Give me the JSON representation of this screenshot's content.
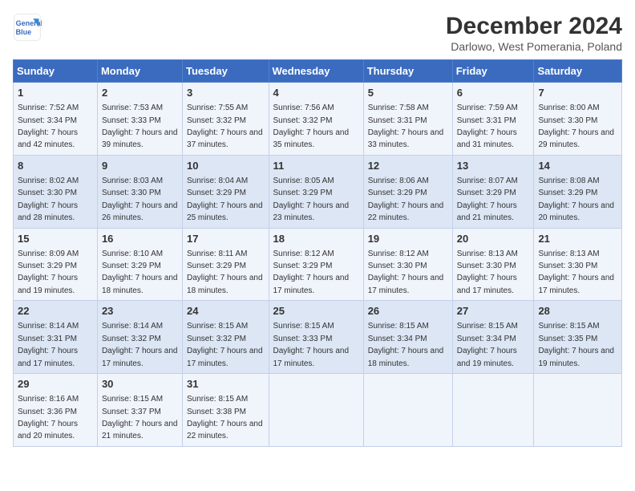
{
  "logo": {
    "line1": "General",
    "line2": "Blue"
  },
  "title": "December 2024",
  "subtitle": "Darlowo, West Pomerania, Poland",
  "weekdays": [
    "Sunday",
    "Monday",
    "Tuesday",
    "Wednesday",
    "Thursday",
    "Friday",
    "Saturday"
  ],
  "weeks": [
    [
      {
        "day": "1",
        "sunrise": "7:52 AM",
        "sunset": "3:34 PM",
        "daylight": "7 hours and 42 minutes."
      },
      {
        "day": "2",
        "sunrise": "7:53 AM",
        "sunset": "3:33 PM",
        "daylight": "7 hours and 39 minutes."
      },
      {
        "day": "3",
        "sunrise": "7:55 AM",
        "sunset": "3:32 PM",
        "daylight": "7 hours and 37 minutes."
      },
      {
        "day": "4",
        "sunrise": "7:56 AM",
        "sunset": "3:32 PM",
        "daylight": "7 hours and 35 minutes."
      },
      {
        "day": "5",
        "sunrise": "7:58 AM",
        "sunset": "3:31 PM",
        "daylight": "7 hours and 33 minutes."
      },
      {
        "day": "6",
        "sunrise": "7:59 AM",
        "sunset": "3:31 PM",
        "daylight": "7 hours and 31 minutes."
      },
      {
        "day": "7",
        "sunrise": "8:00 AM",
        "sunset": "3:30 PM",
        "daylight": "7 hours and 29 minutes."
      }
    ],
    [
      {
        "day": "8",
        "sunrise": "8:02 AM",
        "sunset": "3:30 PM",
        "daylight": "7 hours and 28 minutes."
      },
      {
        "day": "9",
        "sunrise": "8:03 AM",
        "sunset": "3:30 PM",
        "daylight": "7 hours and 26 minutes."
      },
      {
        "day": "10",
        "sunrise": "8:04 AM",
        "sunset": "3:29 PM",
        "daylight": "7 hours and 25 minutes."
      },
      {
        "day": "11",
        "sunrise": "8:05 AM",
        "sunset": "3:29 PM",
        "daylight": "7 hours and 23 minutes."
      },
      {
        "day": "12",
        "sunrise": "8:06 AM",
        "sunset": "3:29 PM",
        "daylight": "7 hours and 22 minutes."
      },
      {
        "day": "13",
        "sunrise": "8:07 AM",
        "sunset": "3:29 PM",
        "daylight": "7 hours and 21 minutes."
      },
      {
        "day": "14",
        "sunrise": "8:08 AM",
        "sunset": "3:29 PM",
        "daylight": "7 hours and 20 minutes."
      }
    ],
    [
      {
        "day": "15",
        "sunrise": "8:09 AM",
        "sunset": "3:29 PM",
        "daylight": "7 hours and 19 minutes."
      },
      {
        "day": "16",
        "sunrise": "8:10 AM",
        "sunset": "3:29 PM",
        "daylight": "7 hours and 18 minutes."
      },
      {
        "day": "17",
        "sunrise": "8:11 AM",
        "sunset": "3:29 PM",
        "daylight": "7 hours and 18 minutes."
      },
      {
        "day": "18",
        "sunrise": "8:12 AM",
        "sunset": "3:29 PM",
        "daylight": "7 hours and 17 minutes."
      },
      {
        "day": "19",
        "sunrise": "8:12 AM",
        "sunset": "3:30 PM",
        "daylight": "7 hours and 17 minutes."
      },
      {
        "day": "20",
        "sunrise": "8:13 AM",
        "sunset": "3:30 PM",
        "daylight": "7 hours and 17 minutes."
      },
      {
        "day": "21",
        "sunrise": "8:13 AM",
        "sunset": "3:30 PM",
        "daylight": "7 hours and 17 minutes."
      }
    ],
    [
      {
        "day": "22",
        "sunrise": "8:14 AM",
        "sunset": "3:31 PM",
        "daylight": "7 hours and 17 minutes."
      },
      {
        "day": "23",
        "sunrise": "8:14 AM",
        "sunset": "3:32 PM",
        "daylight": "7 hours and 17 minutes."
      },
      {
        "day": "24",
        "sunrise": "8:15 AM",
        "sunset": "3:32 PM",
        "daylight": "7 hours and 17 minutes."
      },
      {
        "day": "25",
        "sunrise": "8:15 AM",
        "sunset": "3:33 PM",
        "daylight": "7 hours and 17 minutes."
      },
      {
        "day": "26",
        "sunrise": "8:15 AM",
        "sunset": "3:34 PM",
        "daylight": "7 hours and 18 minutes."
      },
      {
        "day": "27",
        "sunrise": "8:15 AM",
        "sunset": "3:34 PM",
        "daylight": "7 hours and 19 minutes."
      },
      {
        "day": "28",
        "sunrise": "8:15 AM",
        "sunset": "3:35 PM",
        "daylight": "7 hours and 19 minutes."
      }
    ],
    [
      {
        "day": "29",
        "sunrise": "8:16 AM",
        "sunset": "3:36 PM",
        "daylight": "7 hours and 20 minutes."
      },
      {
        "day": "30",
        "sunrise": "8:15 AM",
        "sunset": "3:37 PM",
        "daylight": "7 hours and 21 minutes."
      },
      {
        "day": "31",
        "sunrise": "8:15 AM",
        "sunset": "3:38 PM",
        "daylight": "7 hours and 22 minutes."
      },
      null,
      null,
      null,
      null
    ]
  ],
  "labels": {
    "sunrise": "Sunrise:",
    "sunset": "Sunset:",
    "daylight": "Daylight:"
  }
}
